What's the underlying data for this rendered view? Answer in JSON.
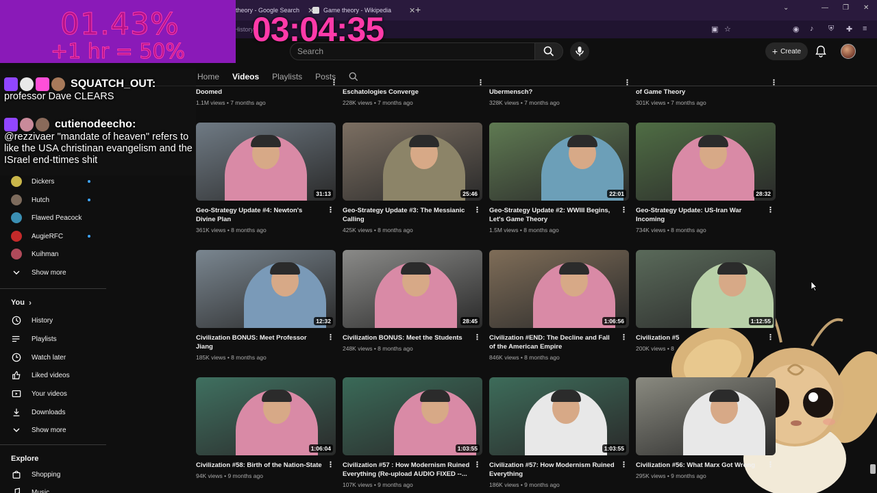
{
  "browser": {
    "tabs": [
      {
        "title": "theory - Google Search"
      },
      {
        "title": "Game theory - Wikipedia"
      }
    ],
    "history_hint": "History"
  },
  "header": {
    "search_placeholder": "Search",
    "create_label": "Create"
  },
  "channel_tabs": [
    "Home",
    "Videos",
    "Playlists",
    "Posts"
  ],
  "active_tab": "Videos",
  "sidebar": {
    "subscriptions": [
      {
        "name": "Dickers",
        "color": "#c9b64a",
        "live": true
      },
      {
        "name": "Hutch",
        "color": "#7d6b5c",
        "live": true
      },
      {
        "name": "Flawed Peacock",
        "color": "#3b8fb3",
        "live": false
      },
      {
        "name": "AugieRFC",
        "color": "#c42a2a",
        "live": true
      },
      {
        "name": "Kuihman",
        "color": "#b04a5a",
        "live": false
      }
    ],
    "show_more_1": "Show more",
    "you_heading": "You",
    "you_items": [
      "History",
      "Playlists",
      "Watch later",
      "Liked videos",
      "Your videos",
      "Downloads"
    ],
    "show_more_2": "Show more",
    "explore_heading": "Explore",
    "explore_items": [
      "Shopping",
      "Music"
    ]
  },
  "videos_top_row": [
    {
      "title": "Doomed",
      "meta": "1.1M views • 7 months ago"
    },
    {
      "title": "Eschatologies Converge",
      "meta": "228K views • 7 months ago"
    },
    {
      "title": "Ubermensch?",
      "meta": "328K views • 7 months ago"
    },
    {
      "title": "of Game Theory",
      "meta": "301K views • 7 months ago"
    }
  ],
  "videos": [
    {
      "title": "Geo-Strategy Update #4: Newton's Divine Plan",
      "meta": "361K views • 8 months ago",
      "duration": "31:13",
      "bg": "#6f7a84",
      "shirt": "#d98aa6"
    },
    {
      "title": "Geo-Strategy Update #3: The Messianic Calling",
      "meta": "425K views • 8 months ago",
      "duration": "25:46",
      "bg": "#7c6f62",
      "shirt": "#8c8468"
    },
    {
      "title": "Geo-Strategy Update #2: WWIII Begins, Let's Game Theory",
      "meta": "1.5M views • 8 months ago",
      "duration": "22:01",
      "bg": "#5f7a52",
      "shirt": "#6c9fb8"
    },
    {
      "title": "Geo-Strategy Update: US-Iran War Incoming",
      "meta": "734K views • 8 months ago",
      "duration": "28:32",
      "bg": "#4f6d44",
      "shirt": "#d98aa6"
    },
    {
      "title": "Civilization BONUS: Meet Professor Jiang",
      "meta": "185K views • 8 months ago",
      "duration": "12:32",
      "bg": "#7a8690",
      "shirt": "#7a9ab8"
    },
    {
      "title": "Civilization BONUS: Meet the Students",
      "meta": "248K views • 8 months ago",
      "duration": "28:45",
      "bg": "#8a8a88",
      "shirt": "#d98aa6"
    },
    {
      "title": "Civilization #END: The Decline and Fall of the American Empire",
      "meta": "846K views • 8 months ago",
      "duration": "1:06:56",
      "bg": "#7f6d58",
      "shirt": "#d98aa6"
    },
    {
      "title": "Civilization #5",
      "meta": "200K views • 8",
      "duration": "1:12:55",
      "bg": "#5a6a5a",
      "shirt": "#b8d0a8"
    },
    {
      "title": "Civilization #58: Birth of the Nation-State",
      "meta": "94K views • 9 months ago",
      "duration": "1:06:04",
      "bg": "#3f7060",
      "shirt": "#d98aa6"
    },
    {
      "title": "Civilization #57 :  How Modernism Ruined Everything (Re-upload AUDIO FIXED --...",
      "meta": "107K views • 9 months ago",
      "duration": "1:03:55",
      "bg": "#3a6a58",
      "shirt": "#d98aa6"
    },
    {
      "title": "Civilization #57: How Modernism Ruined Everything",
      "meta": "186K views • 9 months ago",
      "duration": "1:03:55",
      "bg": "#3d6c5a",
      "shirt": "#e8e8e8"
    },
    {
      "title": "Civilization #56: What Marx Got Wrong",
      "meta": "295K views • 9 months ago",
      "duration": "",
      "bg": "#8a8a80",
      "shirt": "#e8e8e8"
    }
  ],
  "overlay": {
    "stat_percent": "01.43%",
    "stat_rule": "+1 hr = 50%",
    "timer": "03:04:35",
    "chat": [
      {
        "user": "SQUATCH_OUT:",
        "text": "professor Dave CLEARS"
      },
      {
        "user": "cutienodeecho:",
        "text": "@rezzivaer \"mandate of heaven\" refers to like the USA christinan evangelism and the ISrael end-ttimes shit"
      }
    ]
  }
}
